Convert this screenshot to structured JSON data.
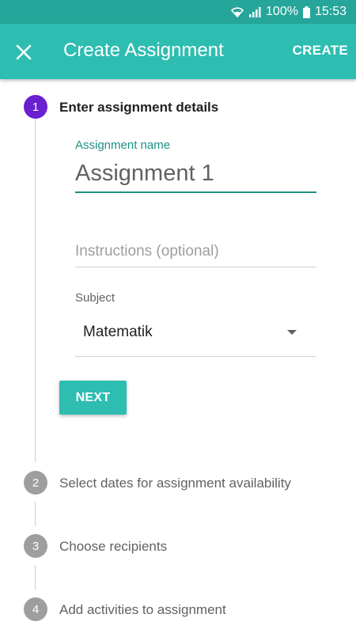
{
  "status_bar": {
    "battery": "100%",
    "time": "15:53",
    "icons": [
      "wifi-icon",
      "signal-icon",
      "battery-icon"
    ]
  },
  "app_bar": {
    "close_icon": "close-icon",
    "title": "Create Assignment",
    "action_label": "CREATE"
  },
  "steps": [
    {
      "number": "1",
      "label": "Enter assignment details",
      "state": "active"
    },
    {
      "number": "2",
      "label": "Select dates for assignment availability",
      "state": "inactive"
    },
    {
      "number": "3",
      "label": "Choose recipients",
      "state": "inactive"
    },
    {
      "number": "4",
      "label": "Add activities to assignment",
      "state": "inactive"
    }
  ],
  "form": {
    "assignment_name_label": "Assignment name",
    "assignment_name_value": "Assignment 1",
    "instructions_placeholder": "Instructions (optional)",
    "subject_label": "Subject",
    "subject_value": "Matematik",
    "next_label": "NEXT"
  },
  "colors": {
    "accent": "#2ebdb1",
    "status_bar": "#26a69a",
    "active_step": "#6a1fd1",
    "inactive_step": "#9e9e9e",
    "focused_label": "#1f8f84"
  }
}
